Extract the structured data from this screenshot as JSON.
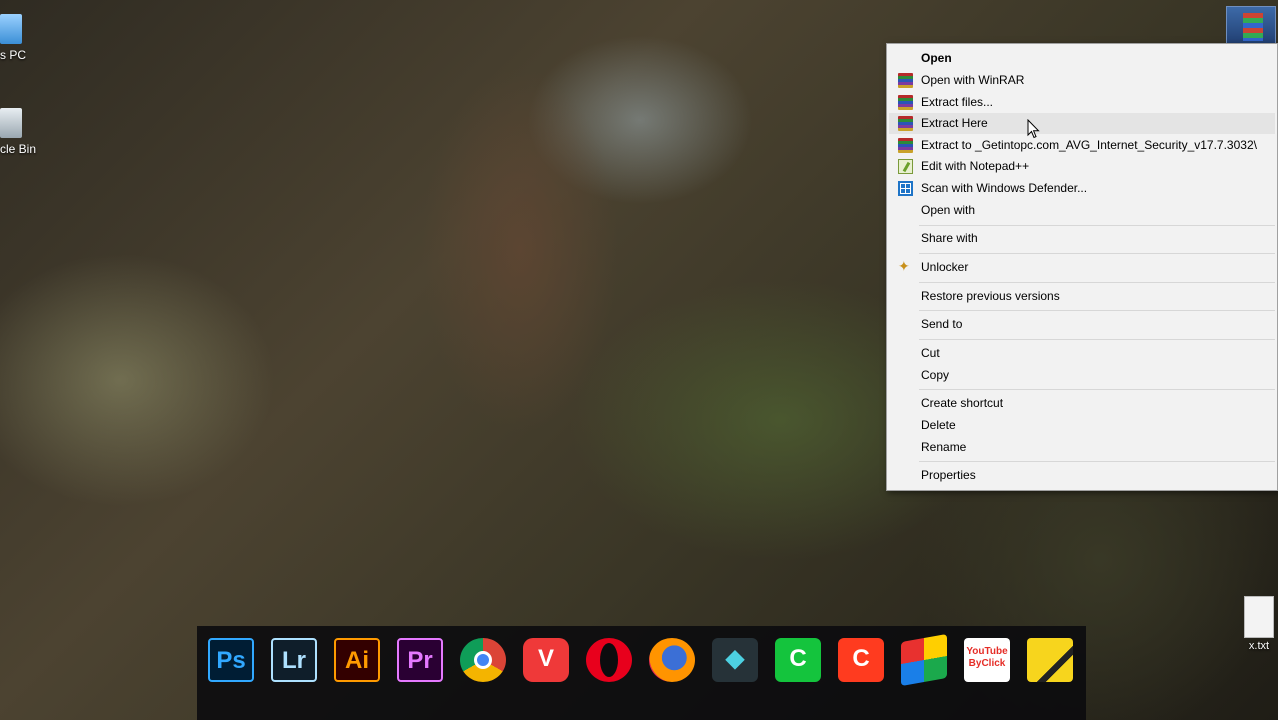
{
  "desktop": {
    "icons": [
      {
        "label": "s PC"
      },
      {
        "label": "cle Bin"
      }
    ],
    "txt_file": {
      "label": "x.txt"
    }
  },
  "context_menu": {
    "items": [
      {
        "label": "Open",
        "bold": true
      },
      {
        "label": "Open with WinRAR",
        "icon": "winrar-icon"
      },
      {
        "label": "Extract files...",
        "icon": "winrar-icon"
      },
      {
        "label": "Extract Here",
        "icon": "winrar-icon",
        "hover": true
      },
      {
        "label": "Extract to _Getintopc.com_AVG_Internet_Security_v17.7.3032\\",
        "icon": "winrar-icon"
      },
      {
        "label": "Edit with Notepad++",
        "icon": "notepad-plus-plus-icon"
      },
      {
        "label": "Scan with Windows Defender...",
        "icon": "windows-defender-icon"
      },
      {
        "label": "Open with"
      },
      {
        "label": "Share with"
      },
      {
        "label": "Unlocker",
        "icon": "magic-wand-icon"
      },
      {
        "label": "Restore previous versions"
      },
      {
        "label": "Send to"
      },
      {
        "label": "Cut"
      },
      {
        "label": "Copy"
      },
      {
        "label": "Create shortcut"
      },
      {
        "label": "Delete"
      },
      {
        "label": "Rename"
      },
      {
        "label": "Properties"
      }
    ]
  },
  "dock": {
    "apps": [
      {
        "name": "photoshop",
        "label": "Ps"
      },
      {
        "name": "lightroom",
        "label": "Lr"
      },
      {
        "name": "illustrator",
        "label": "Ai"
      },
      {
        "name": "premiere",
        "label": "Pr"
      },
      {
        "name": "chrome",
        "label": ""
      },
      {
        "name": "vivaldi",
        "label": "V"
      },
      {
        "name": "opera",
        "label": ""
      },
      {
        "name": "firefox",
        "label": ""
      },
      {
        "name": "tool",
        "label": "◆"
      },
      {
        "name": "camtasia-studio",
        "label": "C"
      },
      {
        "name": "camtasia-recorder",
        "label": "C"
      },
      {
        "name": "bluestacks",
        "label": ""
      },
      {
        "name": "youtube-byclick",
        "label": "YouTube ByClick"
      },
      {
        "name": "stickies",
        "label": ""
      }
    ]
  }
}
